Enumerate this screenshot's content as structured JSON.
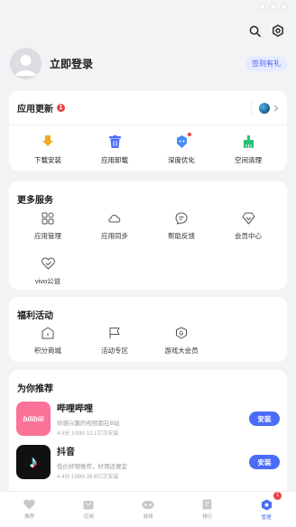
{
  "profile": {
    "login_label": "立即登录",
    "signin_badge": "签到有礼"
  },
  "update_card": {
    "title": "应用更新",
    "badge_count": "1",
    "tools": [
      {
        "label": "下载安装",
        "icon": "download-icon",
        "color": "#f5a623"
      },
      {
        "label": "应用卸载",
        "icon": "trash-icon",
        "color": "#4a6cf7"
      },
      {
        "label": "深度优化",
        "icon": "optimize-icon",
        "color": "#4a8cf7"
      },
      {
        "label": "空间清理",
        "icon": "broom-icon",
        "color": "#2bbf78"
      }
    ]
  },
  "services": {
    "title": "更多服务",
    "items": [
      {
        "label": "应用管理",
        "icon": "apps-grid-icon"
      },
      {
        "label": "应用同步",
        "icon": "cloud-icon"
      },
      {
        "label": "帮助反馈",
        "icon": "chat-icon"
      },
      {
        "label": "会员中心",
        "icon": "diamond-icon"
      },
      {
        "label": "vivo公益",
        "icon": "heart-icon"
      }
    ]
  },
  "welfare": {
    "title": "福利活动",
    "items": [
      {
        "label": "积分商城",
        "icon": "shop-icon"
      },
      {
        "label": "活动专区",
        "icon": "flag-icon"
      },
      {
        "label": "游戏大会员",
        "icon": "game-vip-icon"
      }
    ]
  },
  "recommend": {
    "title": "为你推荐",
    "apps": [
      {
        "name": "哔哩哔哩",
        "desc": "你感兴趣的视频都在B站",
        "meta": "4.4分  100M  13.1亿次安装",
        "button": "安装",
        "icon_color": "#fb7299",
        "icon_text": "bilibili"
      },
      {
        "name": "抖音",
        "desc": "低价好物推荐，好用还便宜",
        "meta": "4.4分  158M  35.6亿次安装",
        "button": "安装",
        "icon_color": "#111111",
        "icon_text": "♪"
      }
    ]
  },
  "tabbar": {
    "tabs": [
      {
        "label": "推荐",
        "icon": "heart-tab-icon"
      },
      {
        "label": "应用",
        "icon": "bag-tab-icon"
      },
      {
        "label": "游戏",
        "icon": "gamepad-tab-icon"
      },
      {
        "label": "排行",
        "icon": "rank-tab-icon"
      },
      {
        "label": "管理",
        "icon": "manage-tab-icon",
        "badge": "1"
      }
    ]
  }
}
